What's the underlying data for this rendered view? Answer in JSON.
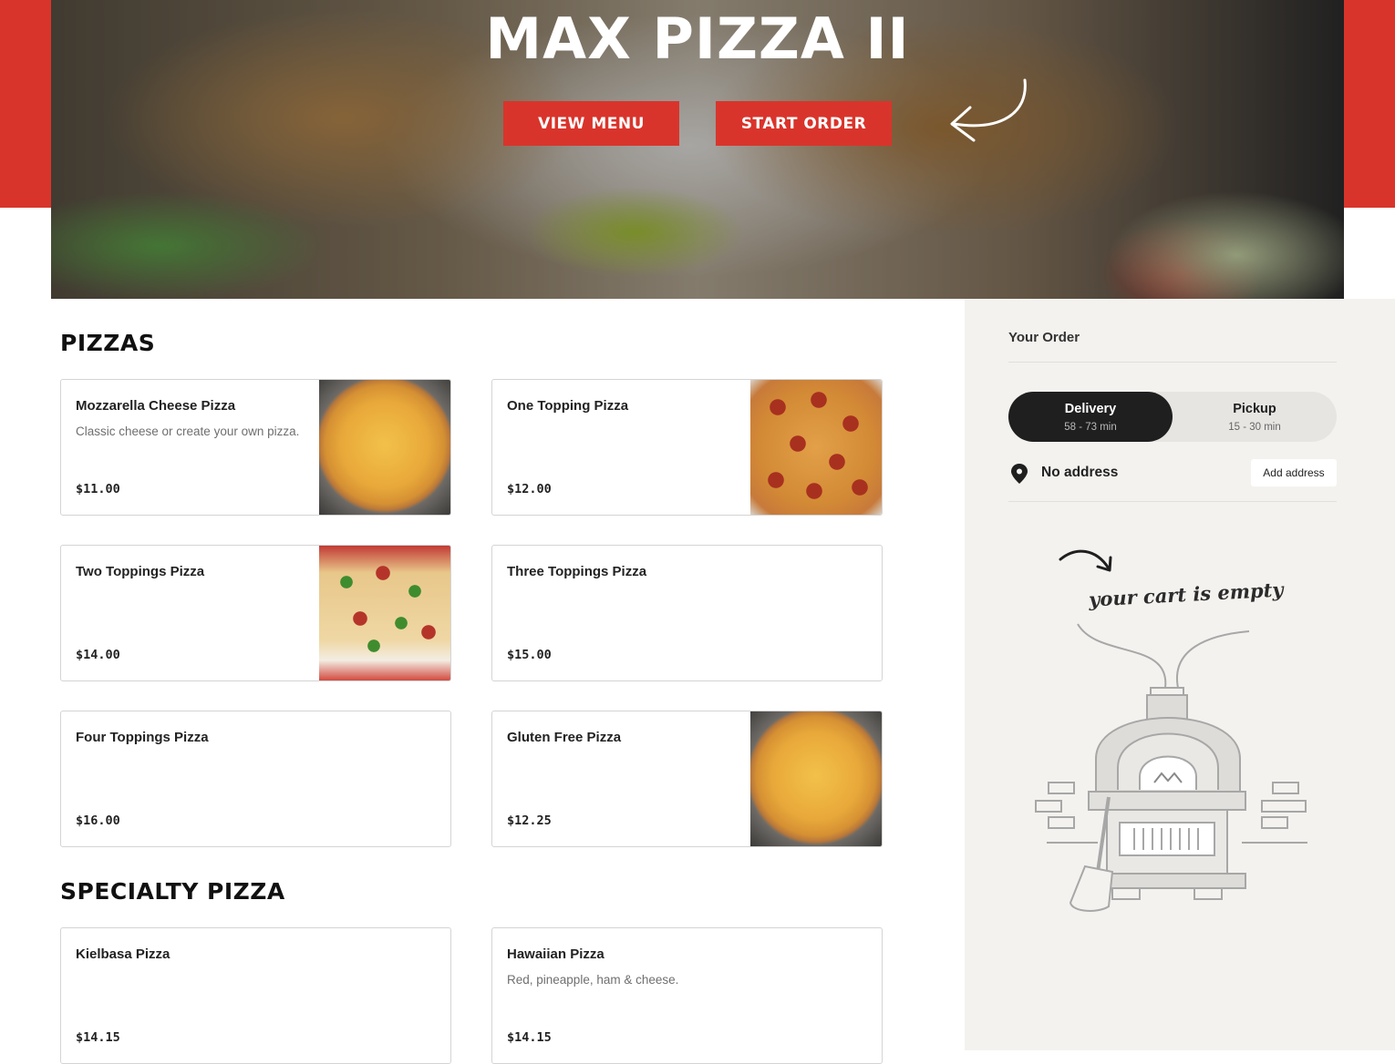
{
  "hero": {
    "title": "MAX PIZZA II",
    "view_menu_label": "VIEW MENU",
    "start_order_label": "START ORDER"
  },
  "menu": {
    "sections": [
      {
        "title": "PIZZAS",
        "items": [
          {
            "name": "Mozzarella Cheese Pizza",
            "description": "Classic cheese or create your own pizza.",
            "price": "$11.00",
            "image": "cheese-pizza"
          },
          {
            "name": "One Topping Pizza",
            "description": "",
            "price": "$12.00",
            "image": "pepperoni-pizza"
          },
          {
            "name": "Two Toppings Pizza",
            "description": "",
            "price": "$14.00",
            "image": "veggie-pizza"
          },
          {
            "name": "Three Toppings Pizza",
            "description": "",
            "price": "$15.00",
            "image": ""
          },
          {
            "name": "Four Toppings Pizza",
            "description": "",
            "price": "$16.00",
            "image": ""
          },
          {
            "name": "Gluten Free Pizza",
            "description": "",
            "price": "$12.25",
            "image": "cheese-pizza"
          }
        ]
      },
      {
        "title": "SPECIALTY PIZZA",
        "items": [
          {
            "name": "Kielbasa Pizza",
            "description": "",
            "price": "$14.15",
            "image": ""
          },
          {
            "name": "Hawaiian Pizza",
            "description": "Red, pineapple, ham & cheese.",
            "price": "$14.15",
            "image": ""
          }
        ]
      }
    ]
  },
  "order": {
    "title": "Your Order",
    "delivery": {
      "label": "Delivery",
      "time": "58 - 73 min",
      "selected": true
    },
    "pickup": {
      "label": "Pickup",
      "time": "15 - 30 min",
      "selected": false
    },
    "address_status": "No address",
    "add_address_label": "Add address",
    "cart_empty_text": "your cart is empty"
  },
  "colors": {
    "brand_red": "#d9342b",
    "toggle_active": "#1f1f1f",
    "sidebar_bg": "#f3f2ef"
  },
  "icons": [
    "hero-arrow-icon",
    "location-pin-icon",
    "cart-arrow-icon",
    "pizza-oven-illustration"
  ]
}
